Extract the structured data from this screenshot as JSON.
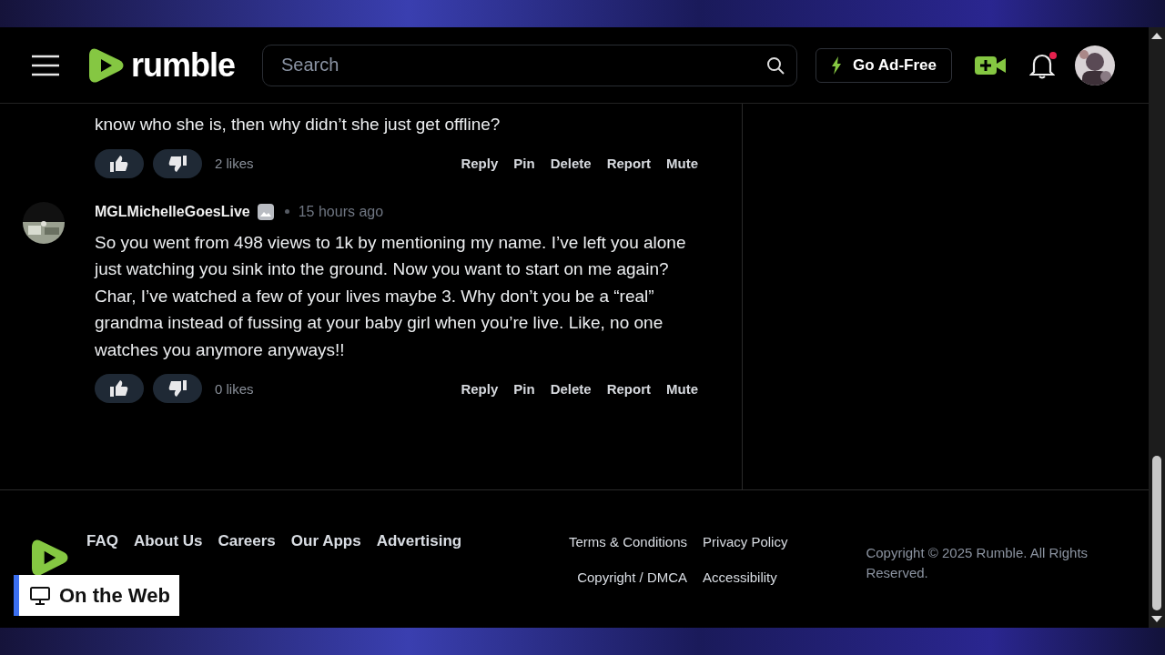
{
  "header": {
    "logo": "rumble",
    "search": {
      "placeholder": "Search"
    },
    "ad_free_button": "Go Ad-Free",
    "notifications": {
      "unread": true
    }
  },
  "comments": [
    {
      "kind": "partial",
      "text": "know who she is, then why didn’t she just get offline?",
      "likes": "2 likes",
      "actions": [
        "Reply",
        "Pin",
        "Delete",
        "Report",
        "Mute"
      ]
    },
    {
      "kind": "full",
      "author": "MGLMichelleGoesLive",
      "time": "15 hours ago",
      "text": "So you went from 498 views to 1k by mentioning my name. I’ve left you alone just watching you sink into the ground. Now you want to start on me again? Char, I’ve watched a few of your lives maybe 3. Why don’t you be a “real” grandma instead of fussing at your baby girl when you’re live. Like, no one watches you anymore anyways!!",
      "likes": "0 likes",
      "actions": [
        "Reply",
        "Pin",
        "Delete",
        "Report",
        "Mute"
      ]
    }
  ],
  "footer": {
    "links": [
      "FAQ",
      "About Us",
      "Careers",
      "Our Apps",
      "Advertising"
    ],
    "legal_links": [
      "Terms & Conditions",
      "Privacy Policy",
      "Copyright / DMCA",
      "Accessibility"
    ],
    "copyright": "Copyright © 2025 Rumble. All Rights Reserved."
  },
  "overlay": {
    "label": "On the Web"
  }
}
